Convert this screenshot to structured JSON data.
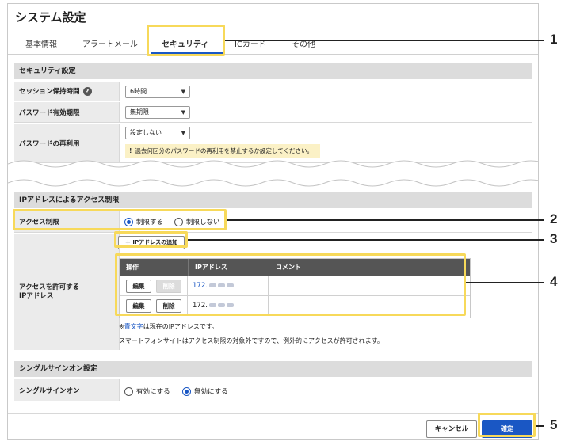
{
  "page_title": "システム設定",
  "tabs": [
    {
      "label": "基本情報"
    },
    {
      "label": "アラートメール"
    },
    {
      "label": "セキュリティ"
    },
    {
      "label": "ICカード"
    },
    {
      "label": "その他"
    }
  ],
  "security_settings": {
    "header": "セキュリティ設定",
    "session": {
      "label": "セッション保持時間",
      "help_icon": "?",
      "value": "6時間"
    },
    "password_expiry": {
      "label": "パスワード有効期限",
      "value": "無期限"
    },
    "password_reuse": {
      "label": "パスワードの再利用",
      "value": "設定しない",
      "warning_mark": "!",
      "warning": "過去何回分のパスワードの再利用を禁止するか設定してください。"
    }
  },
  "ip_access": {
    "header": "IPアドレスによるアクセス制限",
    "restriction": {
      "label": "アクセス制限",
      "option_on": "制限する",
      "option_off": "制限しない"
    },
    "add_button": "＋ IPアドレスの追加",
    "allowed_label": "アクセスを許可する\nIPアドレス",
    "table": {
      "headers": [
        "操作",
        "IPアドレス",
        "コメント"
      ],
      "rows": [
        {
          "edit": "編集",
          "delete": "削除",
          "ip": "172.",
          "current": true,
          "comment": ""
        },
        {
          "edit": "編集",
          "delete": "削除",
          "ip": "172.",
          "current": false,
          "comment": ""
        }
      ]
    },
    "note_prefix": "※",
    "note_blue": "青文字",
    "note_suffix": "は現在のIPアドレスです。",
    "note_2": "スマートフォンサイトはアクセス制限の対象外ですので、例外的にアクセスが許可されます。"
  },
  "sso": {
    "header": "シングルサインオン設定",
    "label": "シングルサインオン",
    "option_on": "有効にする",
    "option_off": "無効にする"
  },
  "footer": {
    "cancel": "キャンセル",
    "ok": "確定"
  },
  "callouts": [
    "1",
    "2",
    "3",
    "4",
    "5"
  ],
  "colors": {
    "accent": "#1a57c4",
    "highlight": "#f7d95a",
    "warning_bg": "#fbf1c6"
  }
}
